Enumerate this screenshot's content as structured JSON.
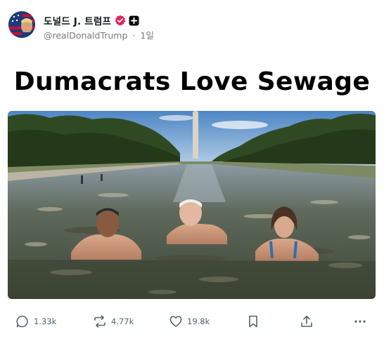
{
  "post": {
    "author_name": "도널드 J. 트럼프",
    "handle": "@realDonaldTrump",
    "separator": "·",
    "time": "1일",
    "headline": "Dumacrats Love Sewage"
  },
  "actions": {
    "replies": "1.33k",
    "reposts": "4.77k",
    "likes": "19.8k"
  },
  "colors": {
    "verified_badge": "#e0245e",
    "text_primary": "#0f1419",
    "text_secondary": "#7a7a7a",
    "icon": "#536471"
  },
  "icons": [
    "avatar-flag",
    "verified-badge-icon",
    "plus-badge-icon",
    "reply-icon",
    "repost-icon",
    "like-icon",
    "bookmark-icon",
    "share-icon",
    "more-icon"
  ]
}
